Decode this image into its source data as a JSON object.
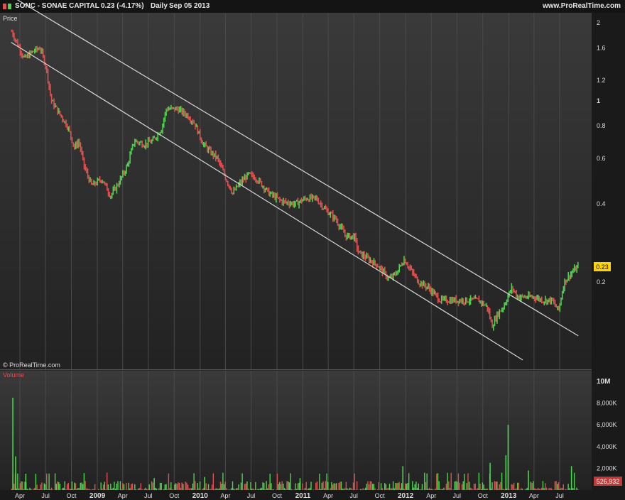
{
  "header": {
    "symbol": "SONC - SONAE CAPITAL",
    "change": "0.23 (-4.17%)",
    "period": "Daily",
    "date": "Sep 05 2013",
    "site": "www.ProRealTime.com"
  },
  "watermark": "© ProRealTime.com",
  "colors": {
    "up": "#4cd44c",
    "down": "#e05050",
    "line": "#d8d8d8",
    "badge": "#ffd400"
  },
  "chart_data": [
    {
      "type": "candlestick",
      "title": "Price",
      "scale": "log",
      "y_ticks": [
        "2",
        "1.6",
        "1.2",
        "1",
        "0.8",
        "0.6",
        "0.4",
        "0.2"
      ],
      "y_tick_values": [
        2,
        1.6,
        1.2,
        1,
        0.8,
        0.6,
        0.4,
        0.2
      ],
      "last_value_label": "0.23",
      "last_value": 0.23,
      "x_range": [
        "2008-03-01",
        "2013-09-05"
      ],
      "series": [
        {
          "values": [
            [
              "2008-03-01",
              1.85
            ],
            [
              "2008-04-15",
              1.45
            ],
            [
              "2008-05-15",
              1.55
            ],
            [
              "2008-06-10",
              1.6
            ],
            [
              "2008-07-01",
              1.35
            ],
            [
              "2008-07-20",
              1.0
            ],
            [
              "2008-08-15",
              0.9
            ],
            [
              "2008-09-15",
              0.8
            ],
            [
              "2008-10-10",
              0.66
            ],
            [
              "2008-10-25",
              0.7
            ],
            [
              "2008-11-15",
              0.55
            ],
            [
              "2008-12-10",
              0.47
            ],
            [
              "2009-01-15",
              0.5
            ],
            [
              "2009-02-15",
              0.43
            ],
            [
              "2009-03-15",
              0.48
            ],
            [
              "2009-04-15",
              0.56
            ],
            [
              "2009-05-10",
              0.7
            ],
            [
              "2009-06-15",
              0.68
            ],
            [
              "2009-07-15",
              0.7
            ],
            [
              "2009-08-15",
              0.78
            ],
            [
              "2009-09-01",
              0.93
            ],
            [
              "2009-10-10",
              0.93
            ],
            [
              "2009-11-15",
              0.88
            ],
            [
              "2009-12-10",
              0.82
            ],
            [
              "2010-01-10",
              0.68
            ],
            [
              "2010-02-01",
              0.64
            ],
            [
              "2010-03-01",
              0.6
            ],
            [
              "2010-04-01",
              0.5
            ],
            [
              "2010-04-25",
              0.44
            ],
            [
              "2010-05-20",
              0.48
            ],
            [
              "2010-06-20",
              0.52
            ],
            [
              "2010-07-20",
              0.5
            ],
            [
              "2010-09-01",
              0.44
            ],
            [
              "2010-10-15",
              0.41
            ],
            [
              "2010-12-01",
              0.4
            ],
            [
              "2011-01-10",
              0.42
            ],
            [
              "2011-02-15",
              0.42
            ],
            [
              "2011-03-20",
              0.38
            ],
            [
              "2011-04-25",
              0.35
            ],
            [
              "2011-06-01",
              0.3
            ],
            [
              "2011-07-01",
              0.3
            ],
            [
              "2011-07-15",
              0.26
            ],
            [
              "2011-08-20",
              0.245
            ],
            [
              "2011-09-25",
              0.23
            ],
            [
              "2011-11-01",
              0.205
            ],
            [
              "2011-11-25",
              0.215
            ],
            [
              "2011-12-25",
              0.245
            ],
            [
              "2012-01-25",
              0.215
            ],
            [
              "2012-02-15",
              0.2
            ],
            [
              "2012-03-20",
              0.19
            ],
            [
              "2012-05-01",
              0.17
            ],
            [
              "2012-06-01",
              0.17
            ],
            [
              "2012-07-15",
              0.17
            ],
            [
              "2012-08-15",
              0.17
            ],
            [
              "2012-09-15",
              0.17
            ],
            [
              "2012-10-15",
              0.16
            ],
            [
              "2012-11-01",
              0.135
            ],
            [
              "2012-11-20",
              0.15
            ],
            [
              "2012-12-10",
              0.16
            ],
            [
              "2013-01-10",
              0.19
            ],
            [
              "2013-02-01",
              0.175
            ],
            [
              "2013-03-01",
              0.175
            ],
            [
              "2013-04-01",
              0.175
            ],
            [
              "2013-05-01",
              0.17
            ],
            [
              "2013-06-01",
              0.17
            ],
            [
              "2013-06-25",
              0.155
            ],
            [
              "2013-07-15",
              0.2
            ],
            [
              "2013-08-15",
              0.22
            ],
            [
              "2013-09-05",
              0.23
            ]
          ]
        }
      ],
      "channel_lines": [
        {
          "start": [
            "2008-03-10",
            2.5
          ],
          "end": [
            "2013-09-05",
            0.124
          ]
        },
        {
          "start": [
            "2008-03-01",
            1.68
          ],
          "end": [
            "2013-02-20",
            0.1
          ]
        }
      ]
    },
    {
      "type": "bar",
      "title": "Volume",
      "y_ticks": [
        "10M",
        "8,000K",
        "6,000K",
        "4,000K",
        "2,000K"
      ],
      "y_tick_values": [
        10000000,
        8000000,
        6000000,
        4000000,
        2000000
      ],
      "last_value_label": "526,932",
      "last_value": 526932,
      "spikes": [
        [
          "2008-03-05",
          8500000
        ],
        [
          "2008-03-15",
          3100000
        ],
        [
          "2008-04-20",
          1500000
        ],
        [
          "2009-07-20",
          1100000
        ],
        [
          "2010-01-15",
          1200000
        ],
        [
          "2010-12-20",
          1100000
        ],
        [
          "2011-12-20",
          2200000
        ],
        [
          "2012-10-25",
          2500000
        ],
        [
          "2012-12-20",
          3200000
        ],
        [
          "2012-12-28",
          6000000
        ],
        [
          "2013-03-10",
          1800000
        ],
        [
          "2013-08-10",
          2200000
        ]
      ]
    }
  ],
  "x_ticks": [
    "Apr",
    "Jul",
    "Oct",
    "2009",
    "Apr",
    "Jul",
    "Oct",
    "2010",
    "Apr",
    "Jul",
    "Oct",
    "2011",
    "Apr",
    "Jul",
    "Oct",
    "2012",
    "Apr",
    "Jul",
    "Oct",
    "2013",
    "Apr",
    "Jul"
  ],
  "x_tick_dates": [
    "2008-04-01",
    "2008-07-01",
    "2008-10-01",
    "2009-01-01",
    "2009-04-01",
    "2009-07-01",
    "2009-10-01",
    "2010-01-01",
    "2010-04-01",
    "2010-07-01",
    "2010-10-01",
    "2011-01-01",
    "2011-04-01",
    "2011-07-01",
    "2011-10-01",
    "2012-01-01",
    "2012-04-01",
    "2012-07-01",
    "2012-10-01",
    "2013-01-01",
    "2013-04-01",
    "2013-07-01"
  ]
}
